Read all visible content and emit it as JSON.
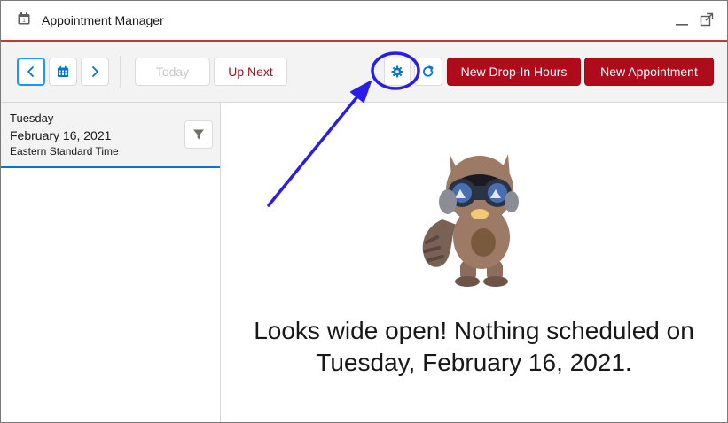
{
  "window": {
    "title": "Appointment Manager",
    "icons": {
      "app": "calendar-icon",
      "minimize": "minimize-icon",
      "popout": "popout-icon"
    }
  },
  "toolbar": {
    "today_label": "Today",
    "up_next_label": "Up Next",
    "new_drop_in_label": "New Drop-In Hours",
    "new_appointment_label": "New Appointment",
    "icons": {
      "prev": "chevron-left-icon",
      "calendar": "calendar-icon",
      "next": "chevron-right-icon",
      "settings": "gear-icon",
      "refresh": "refresh-icon"
    }
  },
  "date_panel": {
    "day": "Tuesday",
    "date": "February 16, 2021",
    "timezone": "Eastern Standard Time",
    "filter_icon": "filter-icon"
  },
  "main": {
    "empty_line1": "Looks wide open! Nothing scheduled on",
    "empty_line2": "Tuesday, February 16, 2021."
  },
  "colors": {
    "brand": "#b00b1b",
    "accent_blue": "#0176d3",
    "annotation": "#2a1ee6",
    "header_rule": "#c23934"
  }
}
